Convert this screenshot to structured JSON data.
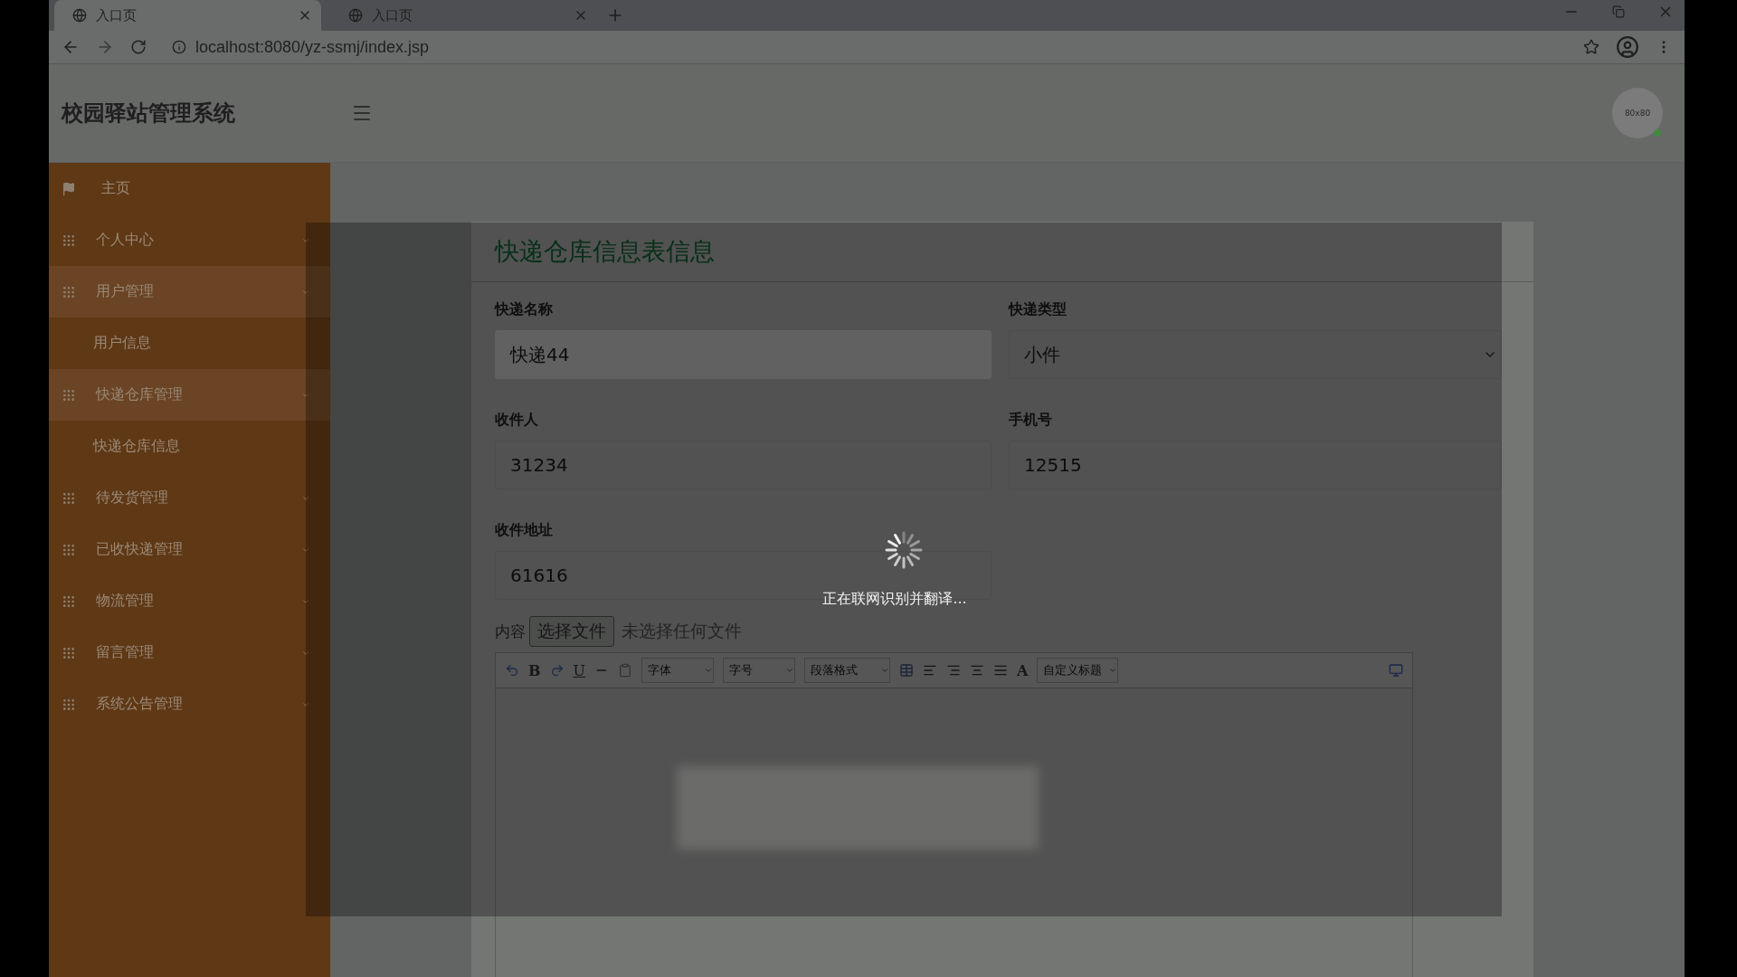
{
  "browser": {
    "tabs": [
      {
        "title": "入口页",
        "selected": true
      },
      {
        "title": "入口页",
        "selected": false
      }
    ],
    "url": "localhost:8080/yz-ssmj/index.jsp"
  },
  "header": {
    "title": "校园驿站管理系统",
    "avatar": "80x80"
  },
  "sidebar": {
    "items": [
      {
        "label": "主页",
        "kind": "flag",
        "expanded": false
      },
      {
        "label": "个人中心",
        "kind": "group",
        "expanded": false
      },
      {
        "label": "用户管理",
        "kind": "group",
        "expanded": true,
        "children": [
          {
            "label": "用户信息"
          }
        ]
      },
      {
        "label": "快递仓库管理",
        "kind": "group",
        "expanded": true,
        "children": [
          {
            "label": "快递仓库信息"
          }
        ]
      },
      {
        "label": "待发货管理",
        "kind": "group",
        "expanded": false
      },
      {
        "label": "已收快递管理",
        "kind": "group",
        "expanded": false
      },
      {
        "label": "物流管理",
        "kind": "group",
        "expanded": false
      },
      {
        "label": "留言管理",
        "kind": "group",
        "expanded": false
      },
      {
        "label": "系统公告管理",
        "kind": "group",
        "expanded": false
      }
    ]
  },
  "form": {
    "title": "快递仓库信息表信息",
    "fields": [
      {
        "label": "快递名称",
        "value": "快递44",
        "kind": "input",
        "readonly": true
      },
      {
        "label": "快递类型",
        "value": "小件",
        "kind": "select",
        "readonly": false
      },
      {
        "label": "收件人",
        "value": "31234",
        "kind": "input",
        "readonly": false
      },
      {
        "label": "手机号",
        "value": "12515",
        "kind": "input",
        "readonly": false
      },
      {
        "label": "收件地址",
        "value": "61616",
        "kind": "input",
        "readonly": false
      }
    ],
    "content_label": "内容",
    "file_button": "选择文件",
    "file_status": "未选择任何文件",
    "toolbar": {
      "bold": "B",
      "underline": "U",
      "font_color": "A",
      "dropdowns": [
        "字体",
        "字号",
        "段落格式",
        "自定义标题"
      ]
    }
  },
  "loading": {
    "text": "正在联网识别并翻译..."
  }
}
